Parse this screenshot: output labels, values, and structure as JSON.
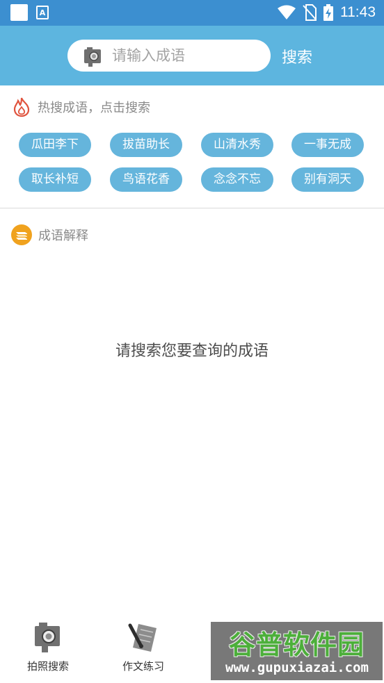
{
  "status_bar": {
    "time": "11:43",
    "notification_letter": "A"
  },
  "header": {
    "search_placeholder": "请输入成语",
    "search_button": "搜索"
  },
  "hot": {
    "title": "热搜成语，点击搜索",
    "tags": [
      "瓜田李下",
      "拔苗助长",
      "山清水秀",
      "一事无成",
      "取长补短",
      "鸟语花香",
      "念念不忘",
      "别有洞天"
    ]
  },
  "explain": {
    "title": "成语解释",
    "empty_message": "请搜索您要查询的成语"
  },
  "bottom_nav": {
    "items": [
      {
        "label": "拍照搜索",
        "icon": "camera-icon"
      },
      {
        "label": "作文练习",
        "icon": "pen-paper-icon"
      }
    ]
  },
  "watermark": {
    "title": "谷普软件园",
    "url": "www.gupuxiazai.com"
  },
  "colors": {
    "status_bar": "#3c8fd0",
    "header": "#5db5df",
    "tag": "#65b5dc",
    "fire": "#e0533d",
    "book": "#f0a21e"
  }
}
